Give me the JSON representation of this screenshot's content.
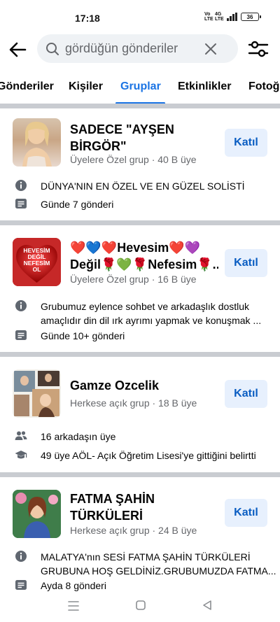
{
  "status_bar": {
    "time": "17:18",
    "battery": "36",
    "network": "Vo LTE",
    "network2": "4G LTE"
  },
  "search": {
    "value": "gördüğün gönderiler"
  },
  "tabs": [
    {
      "label": "Gönderiler"
    },
    {
      "label": "Kişiler"
    },
    {
      "label": "Gruplar"
    },
    {
      "label": "Etkinlikler"
    },
    {
      "label": "Fotoğ"
    }
  ],
  "groups": [
    {
      "title_line1": "SADECE \"AYŞEN",
      "title_line2": "BİRGÖR\"",
      "subtitle": "Üyelere Özel grup · 40 B üye",
      "join_label": "Katıl",
      "meta": [
        {
          "icon": "info-icon",
          "text": "DÜNYA'NIN EN ÖZEL VE EN GÜZEL SOLİSTİ"
        },
        {
          "icon": "posts-icon",
          "text": "Günde 7 gönderi"
        }
      ]
    },
    {
      "title_line1": "❤️💙❤️Hevesim❤️💜",
      "title_line2": "Değil🌹💚🌹Nefesim🌹...",
      "thumb_text_line1": "HEVESİM",
      "thumb_text_line2": "DEĞİL",
      "thumb_text_line3": "NEFESİM",
      "thumb_text_line4": "OL",
      "subtitle": "Üyelere Özel grup · 16 B üye",
      "join_label": "Katıl",
      "meta": [
        {
          "icon": "info-icon",
          "text_line1": "Grubumuz eylence sohbet ve arkadaşlık dostluk",
          "text_line2": "amaçlıdır din dil ırk ayrımı yapmak ve konuşmak ..."
        },
        {
          "icon": "posts-icon",
          "text": "Günde 10+ gönderi"
        }
      ]
    },
    {
      "title_line1": "Gamze Ozcelik",
      "subtitle": "Herkese açık grup · 18 B üye",
      "join_label": "Katıl",
      "meta": [
        {
          "icon": "friends-icon",
          "text": "16 arkadaşın üye"
        },
        {
          "icon": "graduation-cap-icon",
          "text": "49 üye AÖL- Açık Öğretim Lisesi'ye gittiğini belirtti"
        }
      ]
    },
    {
      "title_line1": "FATMA ŞAHİN",
      "title_line2": "TÜRKÜLERİ",
      "subtitle": "Herkese açık grup · 24 B üye",
      "join_label": "Katıl",
      "meta": [
        {
          "icon": "info-icon",
          "text_line1": "MALATYA'nın SESİ FATMA ŞAHİN TÜRKÜLERİ",
          "text_line2": "GRUBUNA HOŞ GELDİNİZ.GRUBUMUZDA FATMA..."
        },
        {
          "icon": "posts-icon",
          "text": "Ayda 8 gönderi"
        }
      ]
    }
  ],
  "colors": {
    "accent": "#1b74e4",
    "join_bg": "#e7f0fd",
    "join_text": "#0a5dc2",
    "secondary_text": "#65676b"
  }
}
